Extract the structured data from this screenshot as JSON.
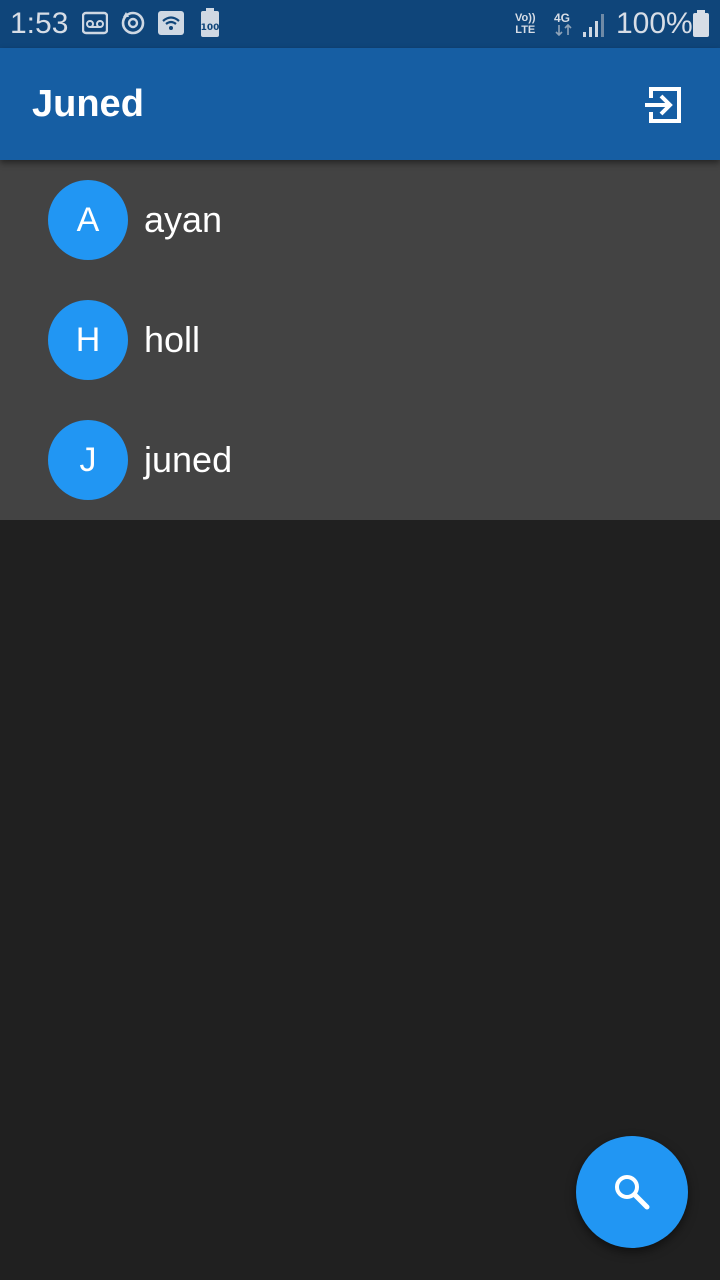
{
  "status_bar": {
    "time": "1:53",
    "icons": [
      "voicemail-icon",
      "sync-icon",
      "wifi-icon",
      "battery-100-icon"
    ],
    "battery_small_label": "100",
    "volte_label_top": "Vo))",
    "volte_label_bottom": "LTE",
    "network_label": "4G",
    "battery_percent": "100%"
  },
  "app_bar": {
    "title": "Juned",
    "action_icon": "logout-icon"
  },
  "colors": {
    "status_bar": "#0f457a",
    "app_bar": "#165ea3",
    "list_background": "#434343",
    "page_background": "#202020",
    "accent": "#2196f3",
    "text": "#ffffff"
  },
  "contacts": [
    {
      "initial": "A",
      "name": "ayan"
    },
    {
      "initial": "H",
      "name": "holl"
    },
    {
      "initial": "J",
      "name": "juned"
    }
  ],
  "fab": {
    "icon": "search-icon"
  }
}
